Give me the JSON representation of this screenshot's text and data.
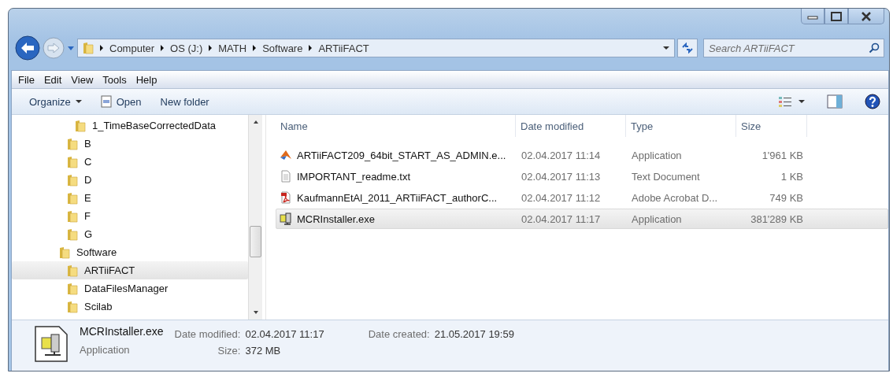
{
  "address": {
    "path": [
      "Computer",
      "OS (J:)",
      "MATH",
      "Software",
      "ARTiiFACT"
    ]
  },
  "search": {
    "placeholder": "Search ARTiiFACT"
  },
  "menu": [
    "File",
    "Edit",
    "View",
    "Tools",
    "Help"
  ],
  "toolbar": [
    {
      "label": "Organize",
      "kind": "dropdown"
    },
    {
      "label": "Open",
      "kind": "icon"
    },
    {
      "label": "New folder",
      "kind": "plain"
    }
  ],
  "tree": [
    {
      "children": [
        {
          "children": [
            {
              "label": "1_TimeBaseCorrectedData",
              "selected": false
            }
          ]
        },
        {
          "label": "B",
          "selected": false
        },
        {
          "label": "C",
          "selected": false
        },
        {
          "label": "D",
          "selected": false
        },
        {
          "label": "E",
          "selected": false
        },
        {
          "label": "F",
          "selected": false
        },
        {
          "label": "G",
          "selected": false
        }
      ]
    },
    {
      "label": "Software",
      "selected": false,
      "children": [
        {
          "label": "ARTiiFACT",
          "selected": true
        },
        {
          "label": "DataFilesManager",
          "selected": false
        },
        {
          "label": "Scilab",
          "selected": false
        }
      ]
    }
  ],
  "columns": [
    "Name",
    "Date modified",
    "Type",
    "Size"
  ],
  "files": [
    {
      "name": "ARTiiFACT209_64bit_START_AS_ADMIN.e...",
      "date": "02.04.2017 11:14",
      "type": "Application",
      "size": "1'961 KB",
      "kind": "matlab",
      "selected": false
    },
    {
      "name": "IMPORTANT_readme.txt",
      "date": "02.04.2017 11:13",
      "type": "Text Document",
      "size": "1 KB",
      "kind": "text",
      "selected": false
    },
    {
      "name": "KaufmannEtAl_2011_ARTiiFACT_authorC...",
      "date": "02.04.2017 11:12",
      "type": "Adobe Acrobat D...",
      "size": "749 KB",
      "kind": "pdf",
      "selected": false
    },
    {
      "name": "MCRInstaller.exe",
      "date": "02.04.2017 11:17",
      "type": "Application",
      "size": "381'289 KB",
      "kind": "installer",
      "selected": true
    }
  ],
  "details": {
    "name": "MCRInstaller.exe",
    "type": "Application",
    "fields": [
      {
        "label": "Date modified:",
        "value": "02.04.2017 11:17"
      },
      {
        "label": "Date created:",
        "value": "21.05.2017 19:59"
      },
      {
        "label": "Size:",
        "value": "372 MB"
      }
    ]
  }
}
